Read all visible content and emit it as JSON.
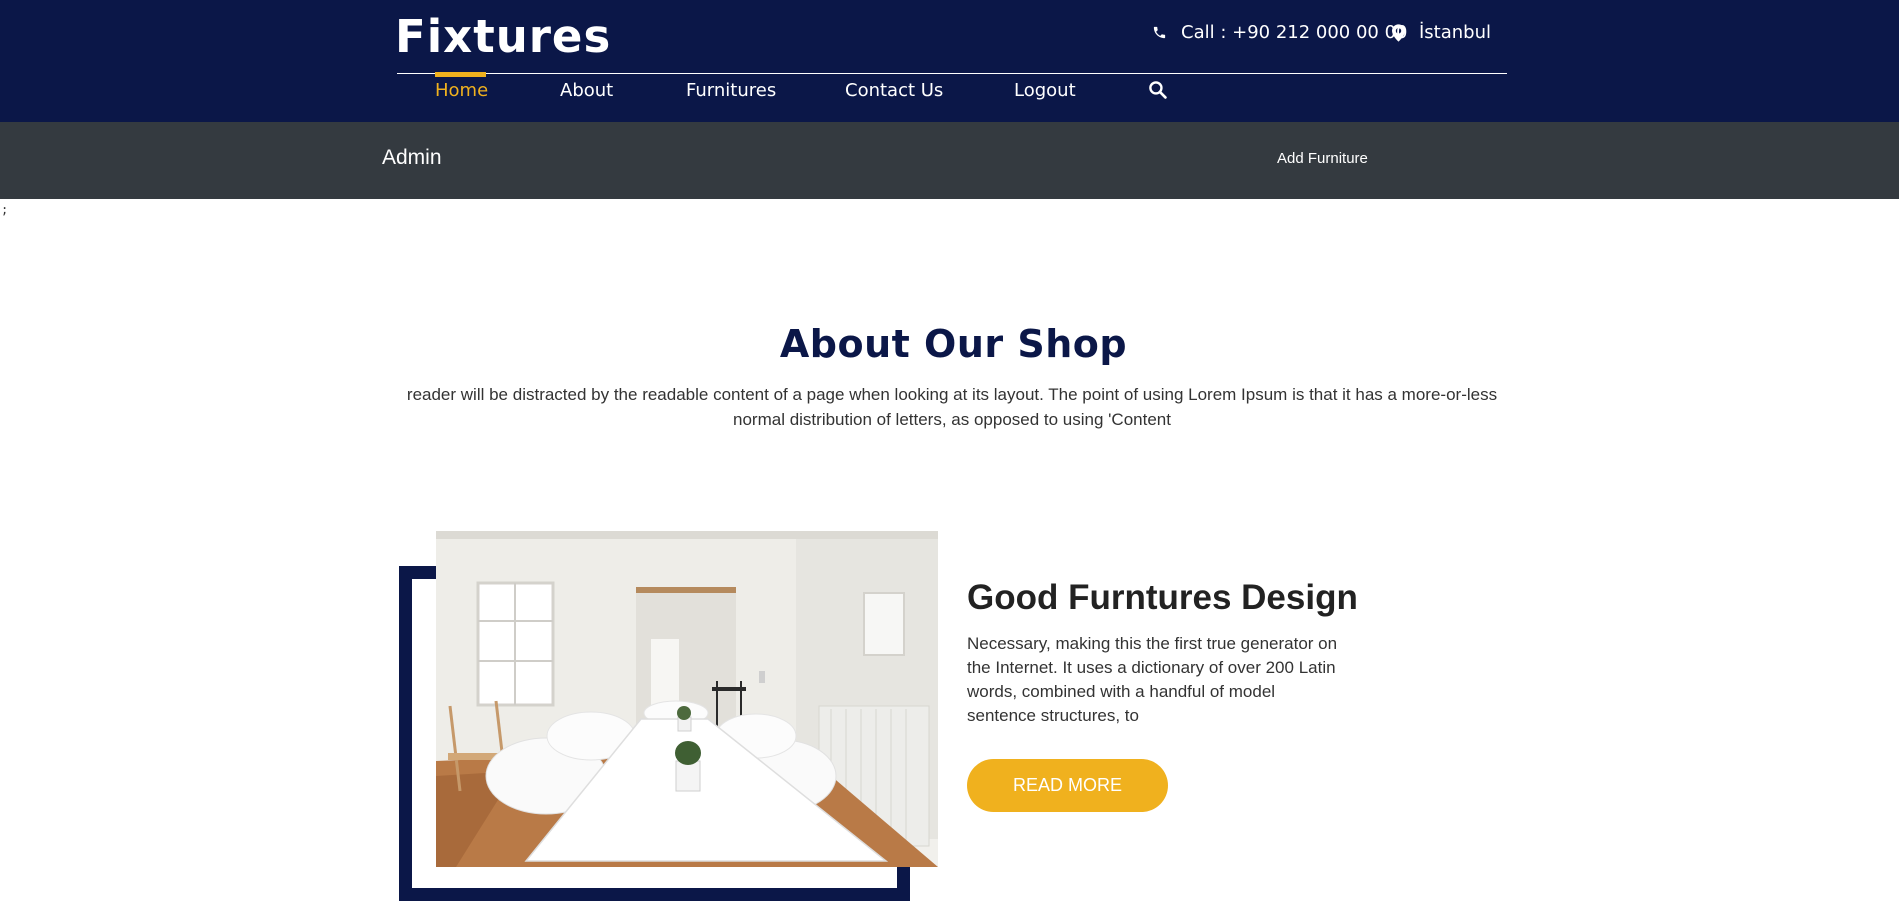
{
  "header": {
    "brand": "Fixtures",
    "phone_text": "Call : +90 212 000 00 00",
    "location_text": "İstanbul",
    "phone_icon": "phone-icon",
    "location_icon": "map-pin-icon",
    "accent_color": "#f0b11e",
    "background_color": "#0b1748"
  },
  "nav": {
    "items": [
      {
        "label": "Home",
        "active": true
      },
      {
        "label": "About",
        "active": false
      },
      {
        "label": "Furnitures",
        "active": false
      },
      {
        "label": "Contact Us",
        "active": false
      },
      {
        "label": "Logout",
        "active": false
      }
    ],
    "search_icon": "search-icon"
  },
  "admin_bar": {
    "title": "Admin",
    "add_link": "Add Furniture",
    "background_color": "#343a40"
  },
  "stray_text": ";",
  "about": {
    "title": "About Our Shop",
    "text": "reader will be distracted by the readable content of a page when looking at its layout. The point of using Lorem Ipsum is that it has a more-or-less normal distribution of letters, as opposed to using 'Content"
  },
  "feature": {
    "title": "Good Furntures Design",
    "text": "Necessary, making this the first true generator on the Internet. It uses a dictionary of over 200 Latin words, combined with a handful of model sentence structures, to",
    "button_label": "READ MORE",
    "image_subject": "white dining room with table and chairs"
  }
}
